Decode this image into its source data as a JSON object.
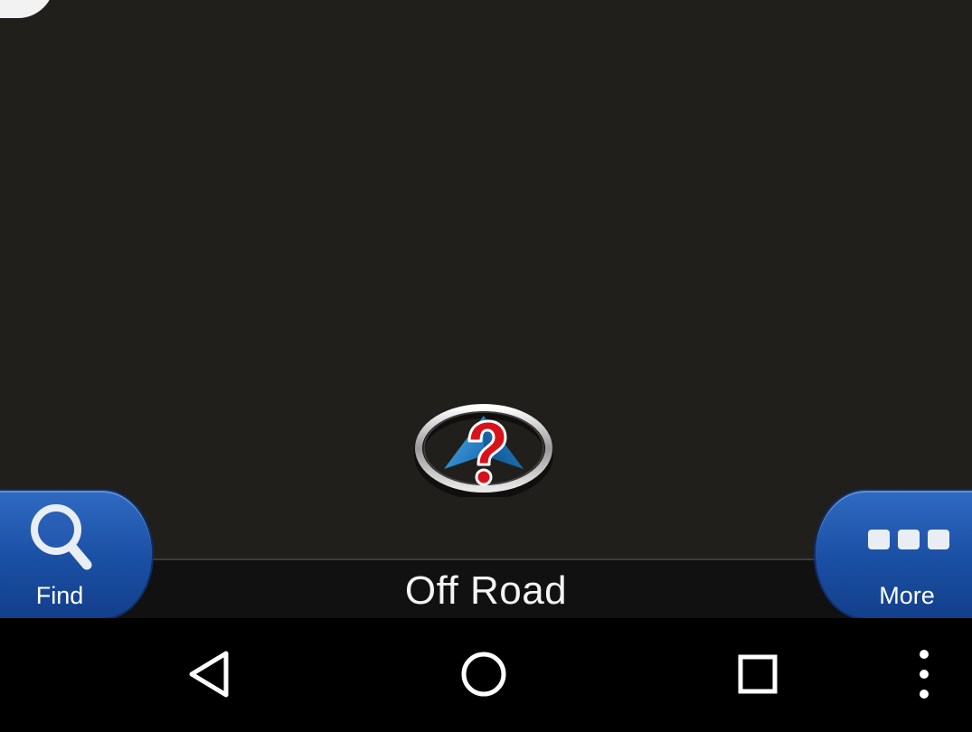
{
  "map": {
    "background_color": "#201f1c",
    "position_marker_icon": "gps-position-unknown-question-icon"
  },
  "status_bar": {
    "text": "Off Road"
  },
  "find_button": {
    "label": "Find",
    "icon": "search-icon",
    "color": "#1a4fa3"
  },
  "more_button": {
    "label": "More",
    "icon": "three-dots-icon",
    "color": "#1a4fa3"
  },
  "nav_bar": {
    "back_icon": "back-triangle-icon",
    "home_icon": "home-circle-icon",
    "recents_icon": "recents-square-icon",
    "menu_icon": "overflow-menu-icon"
  }
}
